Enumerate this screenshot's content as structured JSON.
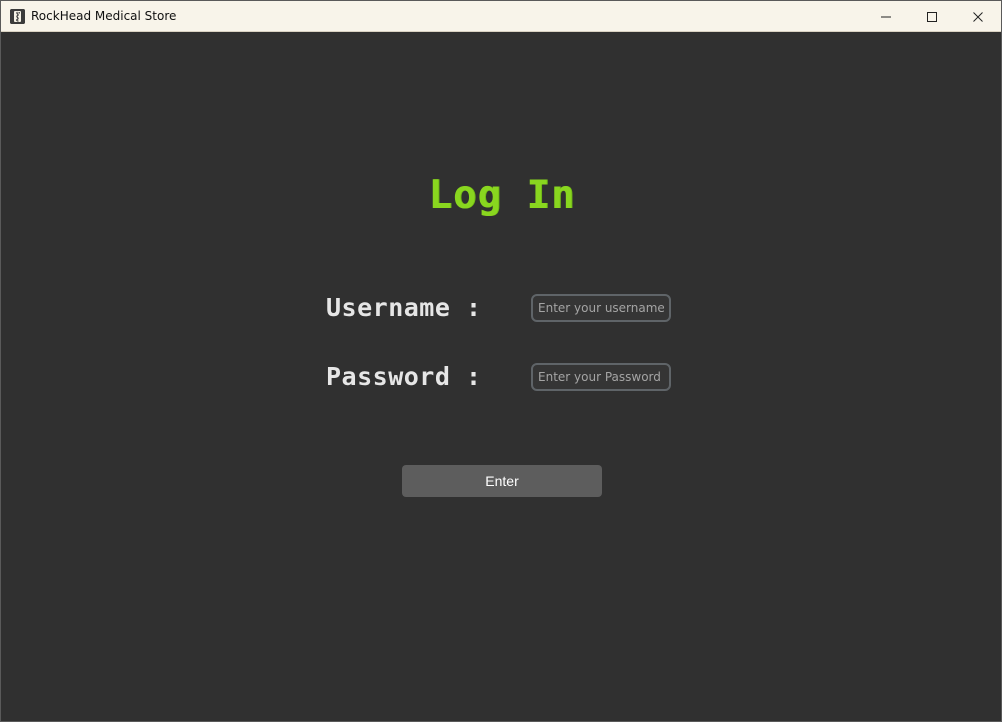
{
  "window": {
    "title": "RockHead Medical Store",
    "controls": {
      "minimize_icon": "minimize-icon",
      "maximize_icon": "maximize-icon",
      "close_icon": "close-icon"
    }
  },
  "login": {
    "heading": "Log In",
    "username_label": "Username :",
    "username_placeholder": "Enter your username",
    "password_label": "Password :",
    "password_placeholder": "Enter your Password",
    "enter_label": "Enter"
  },
  "colors": {
    "window_background": "#303030",
    "title_bar_background": "#f8f4ea",
    "heading": "#89d61f",
    "label_text": "#e6e6e6",
    "input_border": "#5f6468",
    "button_background": "#5d5d5d",
    "button_text": "#ffffff"
  }
}
